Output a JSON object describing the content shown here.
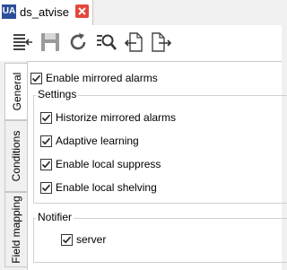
{
  "tab": {
    "logo": "UA",
    "title": "ds_atvise"
  },
  "toolbar": {
    "buttons": [
      {
        "name": "import-icon"
      },
      {
        "name": "save-icon"
      },
      {
        "name": "refresh-icon"
      },
      {
        "name": "find-icon"
      },
      {
        "name": "import-file-icon"
      },
      {
        "name": "export-file-icon"
      }
    ]
  },
  "side_tabs": [
    "General",
    "Conditions",
    "Field mapping"
  ],
  "general": {
    "enable_mirrored": {
      "label": "Enable mirrored alarms",
      "checked": true
    },
    "settings": {
      "title": "Settings",
      "options": [
        {
          "label": "Historize mirrored alarms",
          "checked": true
        },
        {
          "label": "Adaptive learning",
          "checked": true
        },
        {
          "label": "Enable local suppress",
          "checked": true
        },
        {
          "label": "Enable local shelving",
          "checked": true
        }
      ]
    },
    "notifier": {
      "title": "Notifier",
      "items": [
        {
          "label": "server",
          "checked": true
        }
      ]
    }
  },
  "colors": {
    "logo": "#2d4f9a",
    "close": "#e5473a"
  }
}
